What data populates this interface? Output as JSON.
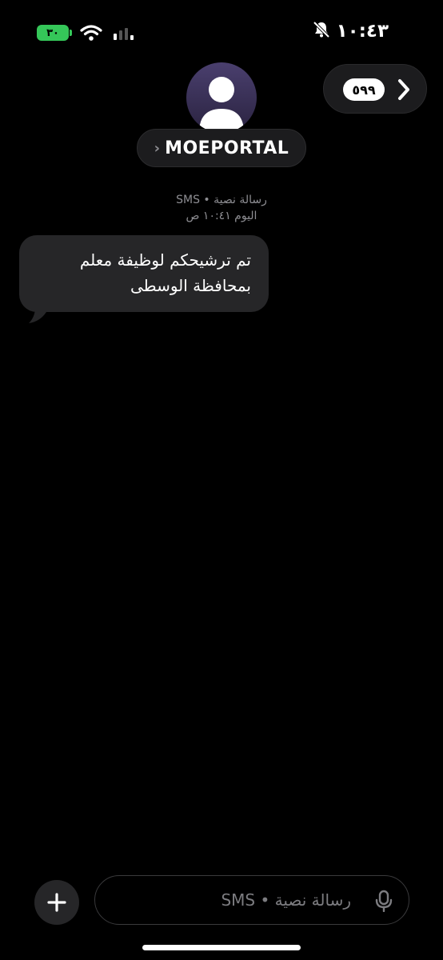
{
  "status_bar": {
    "battery": "٣٠",
    "time": "١٠:٤٣"
  },
  "header": {
    "back_badge": "٥٩٩",
    "contact_name": "MOEPORTAL",
    "contact_chevron": "›"
  },
  "conversation": {
    "service_label": "رسالة نصية • SMS",
    "timestamp": "اليوم ١٠:٤١ ص",
    "messages": [
      {
        "direction": "incoming",
        "text": "تم ترشيحكم لوظيفة معلم بمحافظة الوسطى"
      }
    ]
  },
  "compose": {
    "placeholder": "رسالة نصية • SMS"
  },
  "colors": {
    "background": "#000000",
    "bubble": "#262628",
    "battery": "#35c759",
    "secondary_text": "#8e8e93"
  },
  "icons": [
    "battery-icon",
    "wifi-icon",
    "signal-icon",
    "bell-slash-icon",
    "chevron-right-icon",
    "person-icon",
    "plus-icon",
    "microphone-icon"
  ]
}
